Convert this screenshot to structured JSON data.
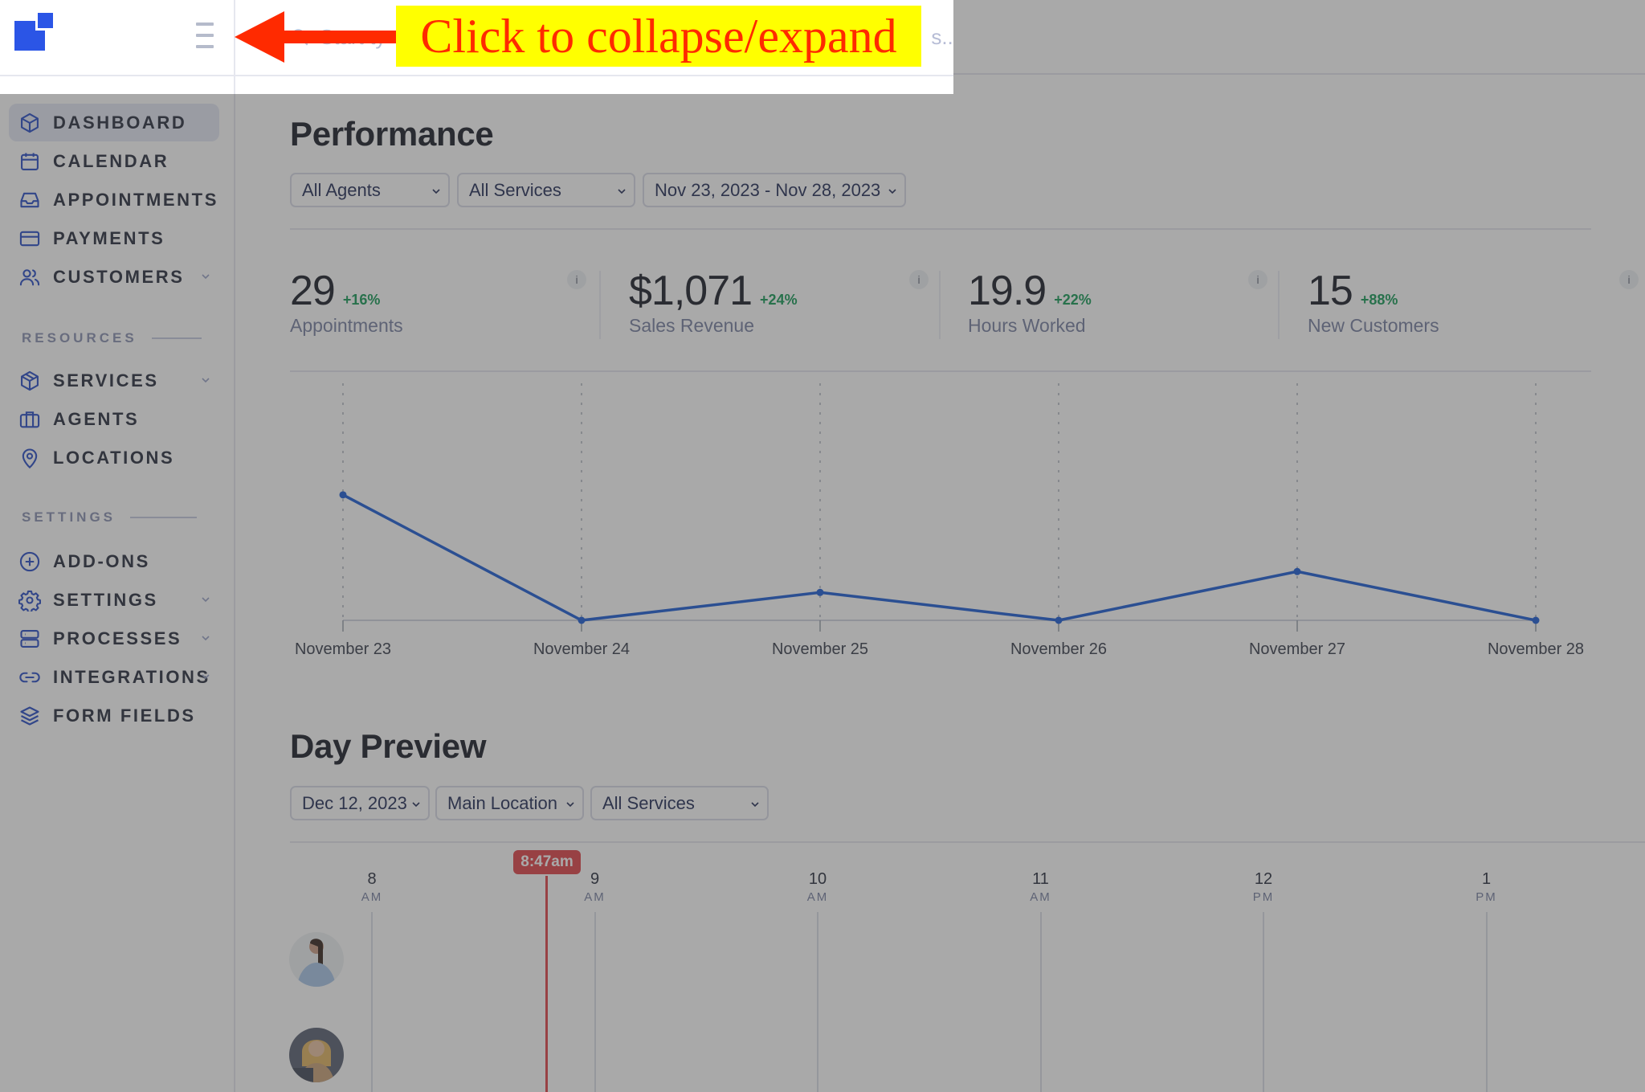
{
  "header": {
    "menu_toggle_icon": "hamburger-icon",
    "search_placeholder_visible_start": "Start ty",
    "search_placeholder_visible_end": "s..."
  },
  "annotation": {
    "label": "Click to collapse/expand",
    "arrow_color": "#ff2a00",
    "highlight_color": "#ffff00"
  },
  "sidebar": {
    "items": [
      {
        "label": "DASHBOARD",
        "icon": "cube-icon",
        "active": true,
        "has_submenu": false
      },
      {
        "label": "CALENDAR",
        "icon": "calendar-icon",
        "active": false,
        "has_submenu": false
      },
      {
        "label": "APPOINTMENTS",
        "icon": "inbox-icon",
        "active": false,
        "has_submenu": false
      },
      {
        "label": "PAYMENTS",
        "icon": "credit-card-icon",
        "active": false,
        "has_submenu": false
      },
      {
        "label": "CUSTOMERS",
        "icon": "users-icon",
        "active": false,
        "has_submenu": true
      }
    ],
    "resources_heading": "RESOURCES",
    "resources": [
      {
        "label": "SERVICES",
        "icon": "package-icon",
        "has_submenu": true
      },
      {
        "label": "AGENTS",
        "icon": "briefcase-icon",
        "has_submenu": false
      },
      {
        "label": "LOCATIONS",
        "icon": "map-pin-icon",
        "has_submenu": false
      }
    ],
    "settings_heading": "SETTINGS",
    "settings": [
      {
        "label": "ADD-ONS",
        "icon": "plus-circle-icon",
        "has_submenu": false
      },
      {
        "label": "SETTINGS",
        "icon": "gear-icon",
        "has_submenu": true
      },
      {
        "label": "PROCESSES",
        "icon": "server-icon",
        "has_submenu": true
      },
      {
        "label": "INTEGRATIONS",
        "icon": "link-icon",
        "has_submenu": true
      },
      {
        "label": "FORM FIELDS",
        "icon": "layers-icon",
        "has_submenu": false
      }
    ]
  },
  "performance": {
    "title": "Performance",
    "filters": {
      "agents": "All Agents",
      "services": "All Services",
      "date_range": "Nov 23, 2023 - Nov 28, 2023"
    },
    "stats": [
      {
        "value": "29",
        "delta": "+16%",
        "label": "Appointments"
      },
      {
        "value": "$1,071",
        "delta": "+24%",
        "label": "Sales Revenue"
      },
      {
        "value": "19.9",
        "delta": "+22%",
        "label": "Hours Worked"
      },
      {
        "value": "15",
        "delta": "+88%",
        "label": "New Customers"
      }
    ],
    "info_glyph": "i"
  },
  "chart_data": {
    "type": "line",
    "title": "",
    "xlabel": "",
    "ylabel": "",
    "categories": [
      "November 23",
      "November 24",
      "November 25",
      "November 26",
      "November 27",
      "November 28"
    ],
    "series": [
      {
        "name": "Appointments",
        "values": [
          18,
          0,
          4,
          0,
          7,
          0
        ],
        "color": "#1f5fd6"
      }
    ],
    "ylim": [
      0,
      34
    ],
    "grid": "vertical-dotted",
    "legend": "none"
  },
  "day_preview": {
    "title": "Day Preview",
    "filters": {
      "date": "Dec 12, 2023",
      "location": "Main Location",
      "services": "All Services"
    },
    "hours": [
      {
        "hour": "8",
        "period": "AM"
      },
      {
        "hour": "9",
        "period": "AM"
      },
      {
        "hour": "10",
        "period": "AM"
      },
      {
        "hour": "11",
        "period": "AM"
      },
      {
        "hour": "12",
        "period": "PM"
      },
      {
        "hour": "1",
        "period": "PM"
      }
    ],
    "now_label": "8:47am",
    "now_fraction_of_hour_after_8am": 0.783,
    "agents": [
      {
        "avatar": "agent-avatar-1"
      },
      {
        "avatar": "agent-avatar-2"
      }
    ]
  }
}
